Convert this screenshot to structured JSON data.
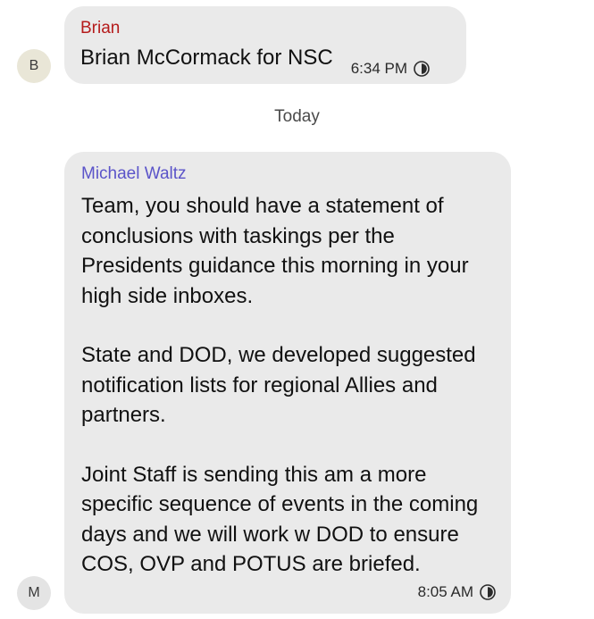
{
  "conversation": {
    "messages": [
      {
        "avatar_letter": "B",
        "sender": "Brian",
        "text": "Brian McCormack for NSC",
        "time": "6:34 PM"
      },
      {
        "avatar_letter": "M",
        "sender": "Michael Waltz",
        "paragraphs": [
          "Team, you should have a statement of conclusions with taskings per the Presidents guidance this morning in your high side inboxes.",
          "State and DOD, we developed suggested notification lists for regional Allies and partners.",
          "Joint Staff is sending this am a more specific sequence of events in the coming days and we will work w DOD to ensure COS, OVP and POTUS are briefed."
        ],
        "time": "8:05 AM"
      }
    ],
    "day_separator": "Today"
  },
  "icons": {
    "disappearing_timer": "timer-icon"
  },
  "colors": {
    "bubble": "#eaeaea",
    "sender_brian": "#b51b1b",
    "sender_waltz": "#5b54c9",
    "avatar_b": "#e9e6d7",
    "avatar_m": "#e4e4e4"
  }
}
